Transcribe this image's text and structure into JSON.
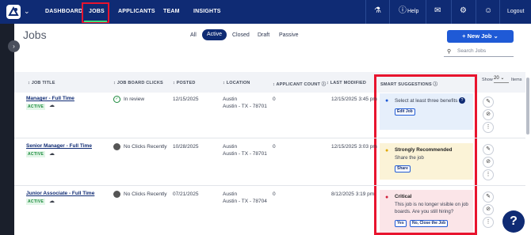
{
  "nav": {
    "items": [
      "DASHBOARD",
      "JOBS",
      "APPLICANTS",
      "TEAM",
      "INSIGHTS"
    ],
    "help_label": "Help",
    "logout_label": "Logout",
    "icons": [
      "logo-icon",
      "flask-icon",
      "help-icon",
      "chat-icon",
      "gear-icon",
      "user-icon"
    ]
  },
  "page": {
    "title": "Jobs",
    "tabs": [
      "All",
      "Active",
      "Closed",
      "Draft",
      "Passive"
    ],
    "active_tab": "Active",
    "new_job_label": "+ New Job",
    "search_placeholder": "Search Jobs"
  },
  "table": {
    "headers": [
      "JOB TITLE",
      "JOB BOARD CLICKS",
      "POSTED",
      "LOCATION",
      "APPLICANT COUNT",
      "LAST MODIFIED",
      "SMART SUGGESTIONS"
    ],
    "show_label": "Show",
    "show_value": "20",
    "items_label": "Items",
    "rows": [
      {
        "title": "Manager - Full Time",
        "status": "ACTIVE",
        "clicks": "In review",
        "posted": "12/15/2025",
        "location_city": "Austin",
        "location_full": "Austin - TX - 78701",
        "applicants": "0",
        "modified": "12/15/2025 3:45 pm",
        "suggestion": {
          "text": "Select at least three benefits",
          "button": "Edit Job"
        }
      },
      {
        "title": "Senior Manager - Full Time",
        "status": "ACTIVE",
        "clicks": "No Clicks Recently",
        "posted": "10/28/2025",
        "location_city": "Austin",
        "location_full": "Austin - TX - 78701",
        "applicants": "0",
        "modified": "12/15/2025 3:03 pm",
        "suggestion": {
          "heading": "Strongly Recommended",
          "text": "Share the job",
          "button": "Share"
        }
      },
      {
        "title": "Junior Associate - Full Time",
        "status": "ACTIVE",
        "clicks": "No Clicks Recently",
        "posted": "07/21/2025",
        "location_city": "Austin",
        "location_full": "Austin - TX - 78704",
        "applicants": "0",
        "modified": "8/12/2025 3:19 pm",
        "suggestion": {
          "heading": "Critical",
          "text_line1": "This job is no longer visible on job",
          "text_line2": "boards. Are you still hiring?",
          "button_yes": "Yes",
          "button_no": "No, Close the Job"
        }
      }
    ]
  },
  "help_fab": "?"
}
